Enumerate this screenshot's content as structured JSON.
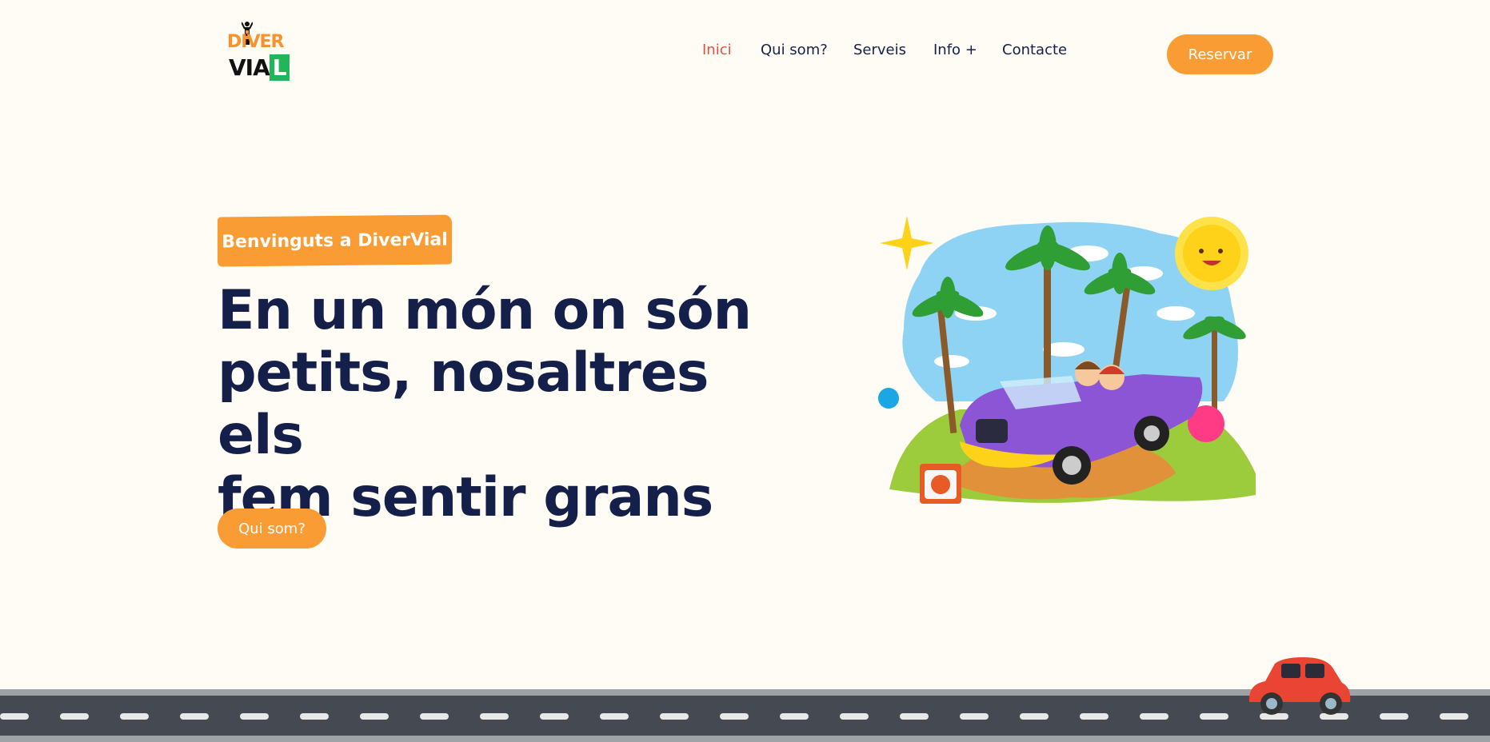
{
  "logo": {
    "line1": "DIVER",
    "line2": "VIA",
    "line2_box": "L"
  },
  "nav": {
    "items": [
      {
        "label": "Inici",
        "active": true
      },
      {
        "label": "Qui som?",
        "active": false
      },
      {
        "label": "Serveis",
        "active": false
      },
      {
        "label": "Info +",
        "active": false
      },
      {
        "label": "Contacte",
        "active": false
      }
    ],
    "cta_label": "Reservar"
  },
  "hero": {
    "tag": "Benvinguts a DiverVial",
    "headline_lines": [
      "En un món on són",
      "petits, nosaltres els",
      "fem sentir grans"
    ],
    "cta_label": "Qui som?"
  },
  "colors": {
    "accent": "#f99c33",
    "active_nav": "#e94e3c",
    "heading": "#14204a",
    "background": "#fffcf5",
    "logo_green": "#22b55a"
  },
  "icons": [
    "logo-figure-icon",
    "sparkle-icon",
    "sun-icon",
    "palm-tree-icon",
    "convertible-car-icon",
    "kid-block-icon",
    "red-car-icon"
  ]
}
